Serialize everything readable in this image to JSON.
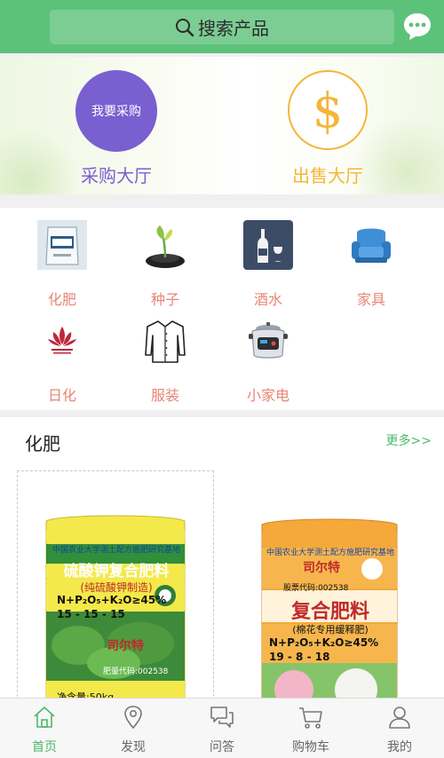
{
  "header": {
    "search_placeholder": "搜索产品",
    "chat_icon": "chat-bubble-icon"
  },
  "hero": {
    "purchase_button": "我要采购",
    "purchase_label": "采购大厅",
    "sell_symbol": "$",
    "sell_label": "出售大厅",
    "colors": {
      "purchase": "#7a5fd0",
      "sell": "#f4b63a"
    }
  },
  "categories": [
    {
      "label": "化肥",
      "icon": "fertilizer-bag-icon"
    },
    {
      "label": "种子",
      "icon": "seedling-icon"
    },
    {
      "label": "酒水",
      "icon": "wine-bottle-icon"
    },
    {
      "label": "家具",
      "icon": "armchair-icon"
    },
    {
      "label": "日化",
      "icon": "lotus-logo-icon"
    },
    {
      "label": "服装",
      "icon": "shirt-icon"
    },
    {
      "label": "小家电",
      "icon": "rice-cooker-icon"
    }
  ],
  "section": {
    "title": "化肥",
    "more": "更多>>",
    "products": [
      {
        "top_text": "中国农业大学测土配方施肥研究基地",
        "name": "硫酸钾复合肥料",
        "subtitle": "(纯硫酸钾制造)",
        "formula": "N+P₂O₅+K₂O≥45%",
        "ratio": "15 - 15 - 15",
        "brand": "司尔特",
        "code": "肥量代码:002538",
        "weight": "净含量:50kg"
      },
      {
        "top_text": "中国农业大学测土配方施肥研究基地",
        "brand": "司尔特",
        "code": "股票代码:002538",
        "name": "复合肥料",
        "subtitle": "(棉花专用缓释肥)",
        "formula": "N+P₂O₅+K₂O≥45%",
        "ratio": "19 - 8 - 18"
      }
    ]
  },
  "tabbar": [
    {
      "label": "首页",
      "icon": "home-icon",
      "active": true
    },
    {
      "label": "发现",
      "icon": "location-pin-icon",
      "active": false
    },
    {
      "label": "问答",
      "icon": "chat-bubbles-icon",
      "active": false
    },
    {
      "label": "购物车",
      "icon": "shopping-cart-icon",
      "active": false
    },
    {
      "label": "我的",
      "icon": "person-icon",
      "active": false
    }
  ]
}
